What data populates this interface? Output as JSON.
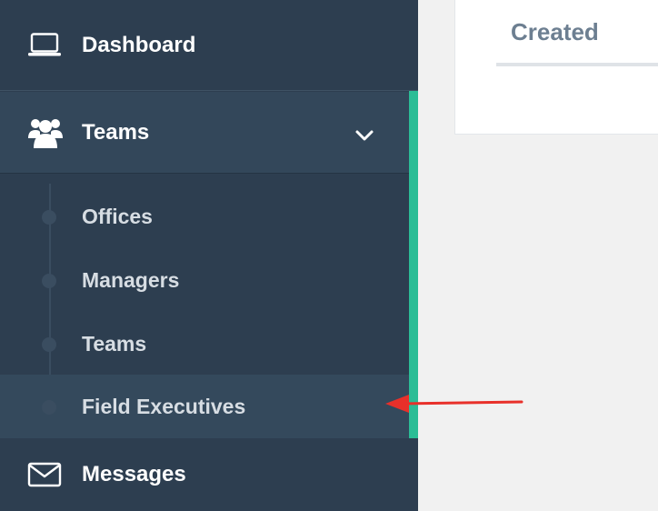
{
  "sidebar": {
    "dashboard": {
      "label": "Dashboard",
      "icon": "laptop-icon"
    },
    "teams": {
      "label": "Teams",
      "icon": "users-icon",
      "expanded": true,
      "submenu": [
        {
          "label": "Offices"
        },
        {
          "label": "Managers"
        },
        {
          "label": "Teams"
        },
        {
          "label": "Field Executives",
          "highlighted": true
        }
      ]
    },
    "messages": {
      "label": "Messages",
      "icon": "envelope-icon"
    }
  },
  "main": {
    "tab_label": "Created"
  },
  "colors": {
    "sidebar_bg": "#2d3e50",
    "accent": "#2bbd96",
    "annotation_arrow": "#e8302a"
  }
}
